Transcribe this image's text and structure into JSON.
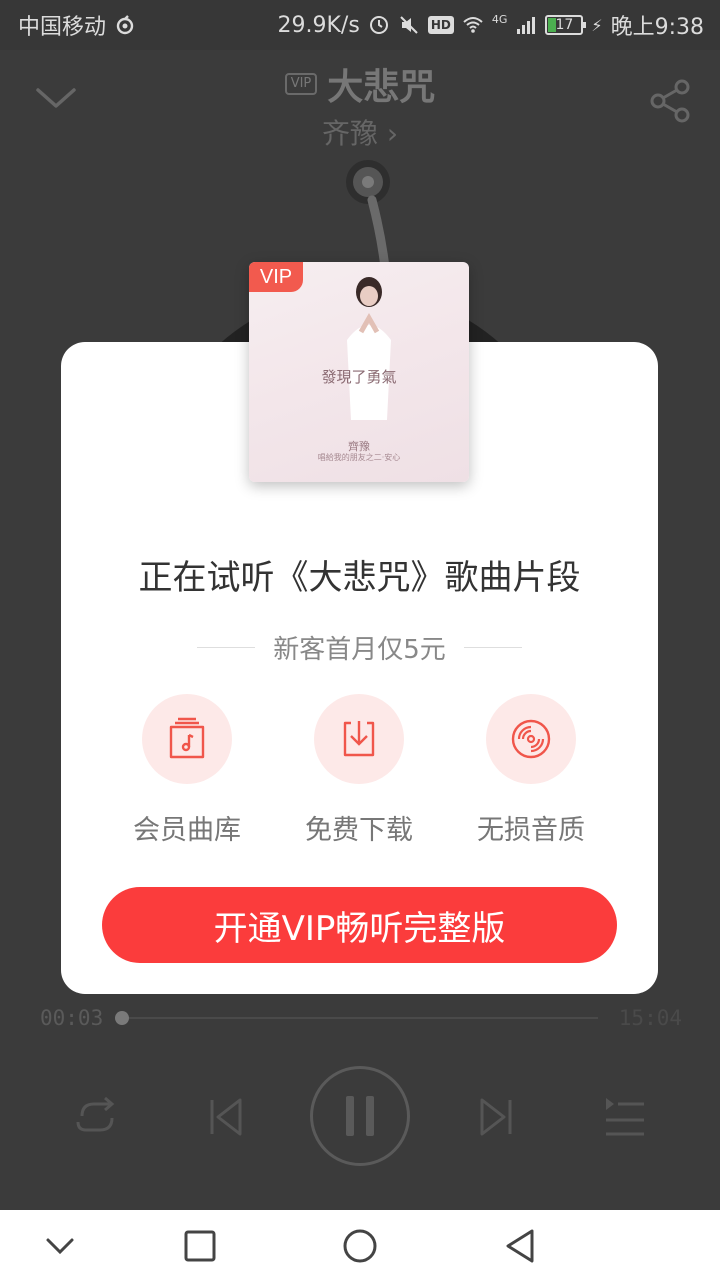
{
  "status_bar": {
    "carrier": "中国移动",
    "speed": "29.9K/s",
    "hd": "HD",
    "network": "4G",
    "battery": "17",
    "time": "晚上9:38"
  },
  "player": {
    "vip_tag": "VIP",
    "song_title": "大悲咒",
    "artist": "齐豫 ›",
    "current_time": "00:03",
    "total_time": "15:04",
    "progress_fraction": 0.003
  },
  "album": {
    "vip_badge": "VIP",
    "cover_text": "發現了勇氣",
    "cover_artist": "齊豫",
    "cover_sub": "唱給我的朋友之二·安心"
  },
  "dialog": {
    "title": "正在试听《大悲咒》歌曲片段",
    "promo": "新客首月仅5元",
    "features": [
      {
        "label": "会员曲库",
        "icon": "music-folder-icon"
      },
      {
        "label": "免费下载",
        "icon": "download-icon"
      },
      {
        "label": "无损音质",
        "icon": "vinyl-disc-icon"
      }
    ],
    "cta_label": "开通VIP畅听完整版"
  },
  "colors": {
    "accent": "#fb3c3c",
    "feature_bg": "#fde9e8",
    "feature_icon": "#f0564b",
    "background": "#3b3b3b"
  }
}
